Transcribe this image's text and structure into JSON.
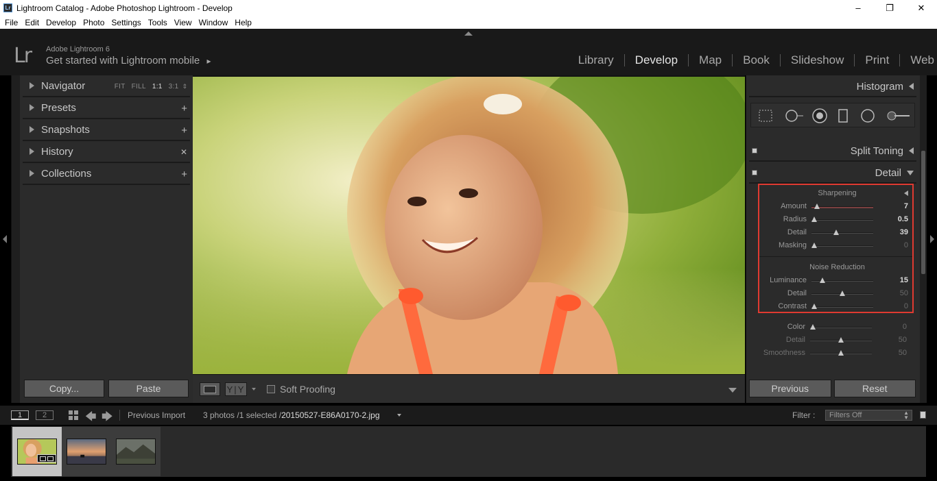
{
  "window": {
    "title": "Lightroom Catalog - Adobe Photoshop Lightroom - Develop",
    "app_badge": "Lr",
    "controls": {
      "minimize": "–",
      "restore": "❐",
      "close": "✕"
    }
  },
  "menu": [
    "File",
    "Edit",
    "Develop",
    "Photo",
    "Settings",
    "Tools",
    "View",
    "Window",
    "Help"
  ],
  "header": {
    "logo": "Lr",
    "product": "Adobe Lightroom 6",
    "mobile_prompt": "Get started with Lightroom mobile",
    "mobile_arrow": "▸",
    "modules": [
      {
        "label": "Library",
        "active": false
      },
      {
        "label": "Develop",
        "active": true
      },
      {
        "label": "Map",
        "active": false
      },
      {
        "label": "Book",
        "active": false
      },
      {
        "label": "Slideshow",
        "active": false
      },
      {
        "label": "Print",
        "active": false
      },
      {
        "label": "Web",
        "active": false
      }
    ]
  },
  "left_panel": {
    "navigator": {
      "label": "Navigator",
      "zoom_options": [
        "FIT",
        "FILL",
        "1:1",
        "3:1"
      ],
      "zoom_selected": "1:1",
      "zoom_arrows": "⇕"
    },
    "presets": {
      "label": "Presets",
      "action": "+"
    },
    "snapshots": {
      "label": "Snapshots",
      "action": "+"
    },
    "history": {
      "label": "History",
      "action": "✕"
    },
    "collections": {
      "label": "Collections",
      "action": "+"
    },
    "buttons": {
      "copy": "Copy...",
      "paste": "Paste"
    }
  },
  "toolbar": {
    "yy_label": "Y|Y",
    "soft_proofing": "Soft Proofing"
  },
  "right_panel": {
    "histogram": "Histogram",
    "split_toning": "Split Toning",
    "detail": "Detail",
    "sharpening": {
      "title": "Sharpening",
      "sliders": [
        {
          "label": "Amount",
          "value": "7",
          "pos": 0.05,
          "dim": false
        },
        {
          "label": "Radius",
          "value": "0.5",
          "pos": 0.0,
          "dim": false
        },
        {
          "label": "Detail",
          "value": "39",
          "pos": 0.39,
          "dim": false
        },
        {
          "label": "Masking",
          "value": "0",
          "pos": 0.0,
          "dim": true
        }
      ]
    },
    "noise_reduction": {
      "title": "Noise Reduction",
      "sliders": [
        {
          "label": "Luminance",
          "value": "15",
          "pos": 0.15,
          "dim": false
        },
        {
          "label": "Detail",
          "value": "50",
          "pos": 0.5,
          "dim": true
        },
        {
          "label": "Contrast",
          "value": "0",
          "pos": 0.0,
          "dim": true
        }
      ]
    },
    "color": {
      "sliders": [
        {
          "label": "Color",
          "value": "0",
          "pos": 0.0,
          "dim": true
        },
        {
          "label": "Detail",
          "value": "50",
          "pos": 0.5,
          "dim": true
        },
        {
          "label": "Smoothness",
          "value": "50",
          "pos": 0.5,
          "dim": true
        }
      ]
    },
    "buttons": {
      "previous": "Previous",
      "reset": "Reset"
    }
  },
  "filmstrip_bar": {
    "screen1": "1",
    "screen2": "2",
    "source": "Previous Import",
    "count": "3 photos /1 selected /",
    "filename": "20150527-E86A0170-2.jpg",
    "filter_label": "Filter :",
    "filter_value": "Filters Off"
  },
  "colors": {
    "accent_highlight": "#e03a31",
    "panel_bg": "#2b2b2b",
    "app_bg": "#191919"
  }
}
